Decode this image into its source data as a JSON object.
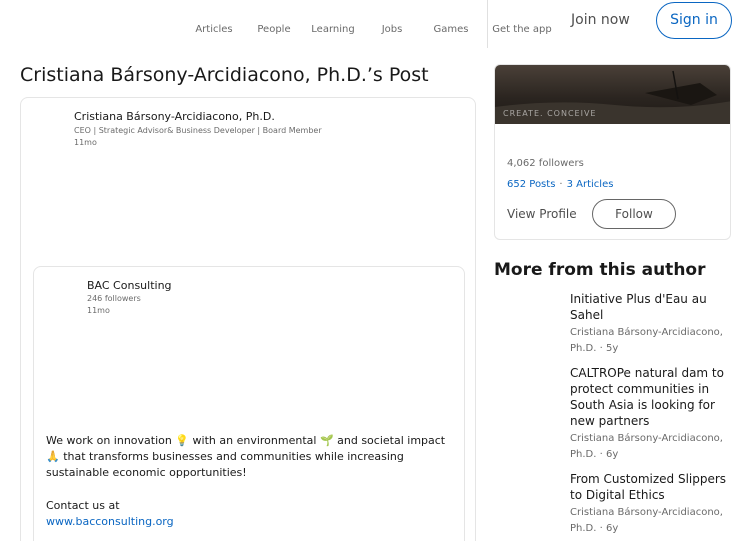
{
  "nav": {
    "items": [
      {
        "label": "Articles",
        "icon": "articles-icon"
      },
      {
        "label": "People",
        "icon": "people-icon"
      },
      {
        "label": "Learning",
        "icon": "learning-icon"
      },
      {
        "label": "Jobs",
        "icon": "jobs-icon"
      },
      {
        "label": "Games",
        "icon": "games-icon"
      }
    ],
    "get_app": "Get the app",
    "join": "Join now",
    "sign_in": "Sign in"
  },
  "page_title": "Cristiana Bársony-Arcidiacono, Ph.D.’s Post",
  "post": {
    "author": "Cristiana Bársony-Arcidiacono, Ph.D.",
    "headline": "CEO | Strategic Advisor& Business Developer | Board Member",
    "time": "11mo",
    "company": {
      "name": "BAC Consulting",
      "followers": "246 followers",
      "time": "11mo",
      "text": "We work on innovation 💡 with an environmental 🌱 and societal impact 🙏 that transforms businesses and communities while increasing sustainable economic opportunities!",
      "contact": "Contact us at",
      "website": "www.bacconsulting.org"
    }
  },
  "profile": {
    "banner_text": "CREATE. CONCEIVE",
    "followers": "4,062 followers",
    "posts": "652 Posts",
    "articles": "3 Articles",
    "separator": "·",
    "view_profile": "View Profile",
    "follow": "Follow"
  },
  "more": {
    "title": "More from this author",
    "items": [
      {
        "title": "Initiative Plus d'Eau au Sahel",
        "author": "Cristiana Bársony-Arcidiacono, Ph.D.",
        "age": "5y"
      },
      {
        "title": "CALTROPe natural dam to protect communities in South Asia is looking for new partners",
        "author": "Cristiana Bársony-Arcidiacono, Ph.D.",
        "age": "6y"
      },
      {
        "title": "From Customized Slippers to Digital Ethics",
        "author": "Cristiana Bársony-Arcidiacono, Ph.D.",
        "age": "6y"
      }
    ]
  }
}
